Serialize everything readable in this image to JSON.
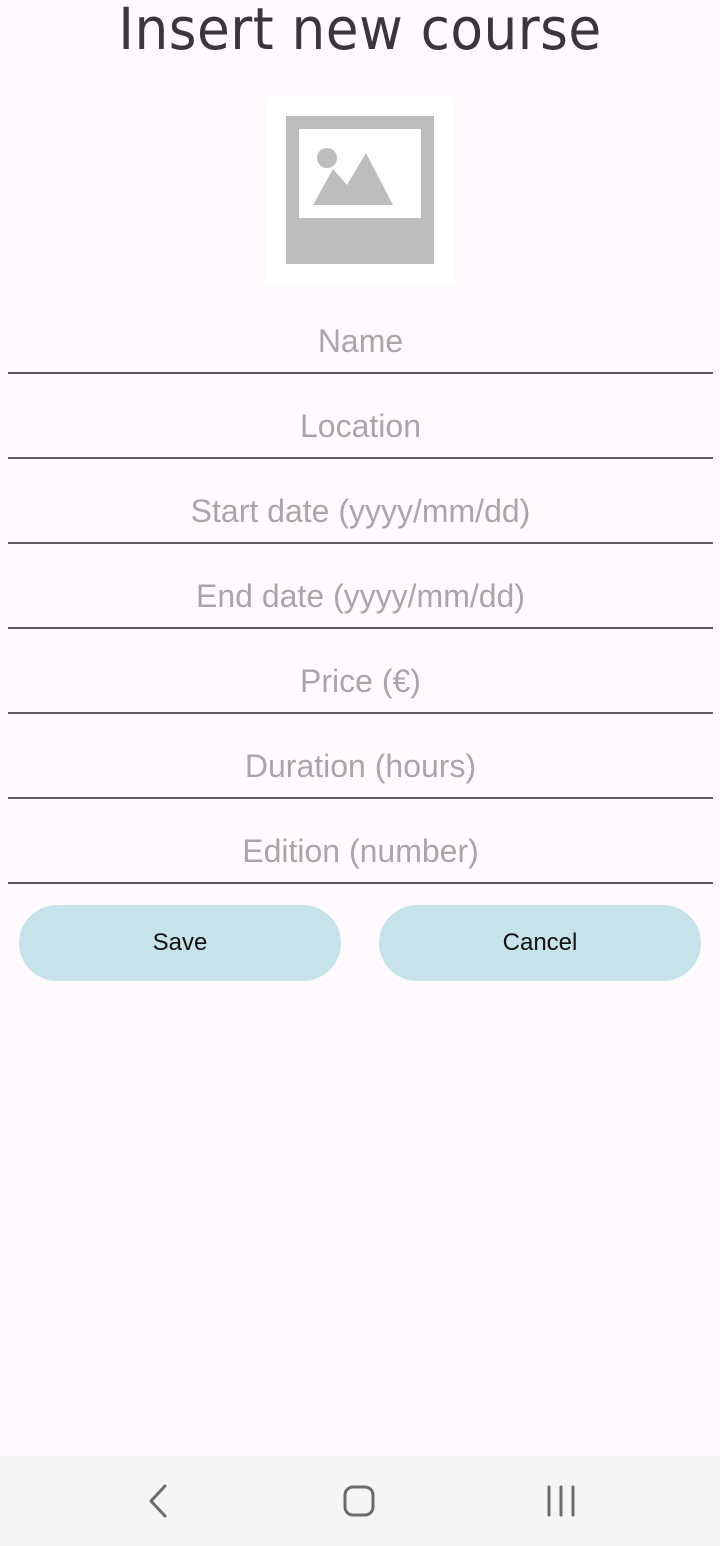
{
  "header": {
    "title": "Insert new course"
  },
  "image_placeholder": {
    "icon": "image-placeholder-icon"
  },
  "form": {
    "fields": [
      {
        "placeholder": "Name",
        "value": ""
      },
      {
        "placeholder": "Location",
        "value": ""
      },
      {
        "placeholder": "Start date (yyyy/mm/dd)",
        "value": ""
      },
      {
        "placeholder": "End date (yyyy/mm/dd)",
        "value": ""
      },
      {
        "placeholder": "Price (€)",
        "value": ""
      },
      {
        "placeholder": "Duration (hours)",
        "value": ""
      },
      {
        "placeholder": "Edition (number)",
        "value": ""
      }
    ]
  },
  "actions": {
    "save_label": "Save",
    "cancel_label": "Cancel"
  },
  "nav": {
    "back_icon": "back-chevron-icon",
    "home_icon": "home-icon",
    "recents_icon": "recents-icon"
  },
  "colors": {
    "background": "#fefafd",
    "button": "#c6e2eb",
    "underline": "#5e5a62",
    "placeholder": "#a9a6aa",
    "navbar": "#f5f5f5"
  }
}
